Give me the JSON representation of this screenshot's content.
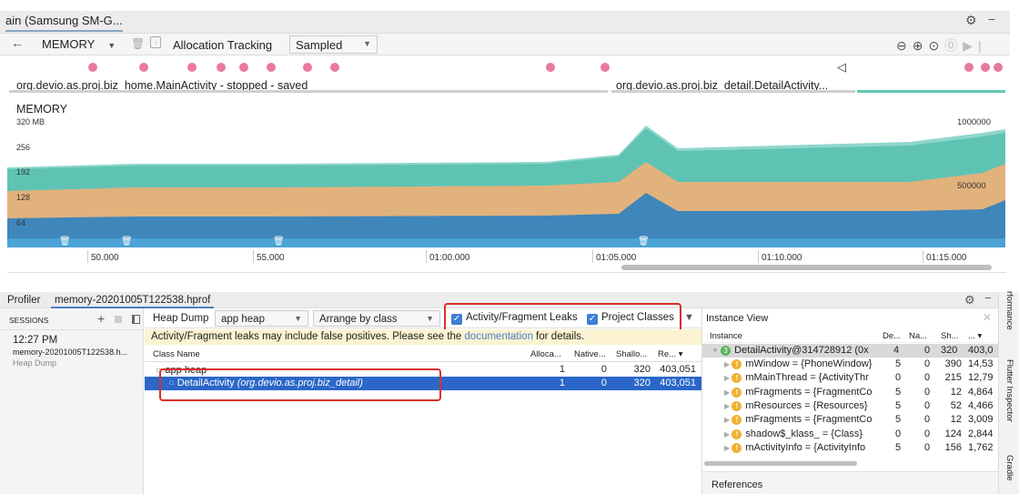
{
  "window": {
    "tab_title": "ain (Samsung SM-G..."
  },
  "toolbar": {
    "profiler_select": "MEMORY",
    "allocation_tracking_label": "Allocation Tracking",
    "allocation_mode": "Sampled"
  },
  "events": {
    "left_activity": "org.devio.as.proj.biz_home.MainActivity - stopped - saved",
    "right_activity": "org.devio.as.proj.biz_detail.DetailActivity...",
    "event_color": "#e879a0"
  },
  "chart": {
    "title": "MEMORY",
    "y_ticks": [
      "320 MB",
      "256",
      "192",
      "128",
      "64"
    ],
    "right_ticks": [
      "1000000",
      "500000"
    ],
    "x_ticks": [
      "50.000",
      "55.000",
      "01:00.000",
      "01:05.000",
      "01:10.000",
      "01:15.000"
    ],
    "layer_colors": {
      "java": "#3f86bb",
      "native": "#e2b27c",
      "graphics": "#5fc3b3",
      "code": "#8fd6cc",
      "other": "#4ba3d6"
    }
  },
  "bottom": {
    "tabs": [
      "Profiler",
      "memory-20201005T122538.hprof"
    ]
  },
  "sessions": {
    "header": "SESSIONS",
    "time": "12:27 PM",
    "name": "memory-20201005T122538.h...",
    "type": "Heap Dump"
  },
  "heap": {
    "view_label": "Heap Dump",
    "heap_select": "app heap",
    "arrange_select": "Arrange by class",
    "leaks_checkbox": "Activity/Fragment Leaks",
    "project_checkbox": "Project Classes",
    "warning_prefix": "Activity/Fragment leaks may include false positives. Please see the ",
    "warning_link": "documentation",
    "warning_suffix": " for details.",
    "columns": [
      "Class Name",
      "Alloca...",
      "Native...",
      "Shallo...",
      "Re..."
    ],
    "rows": [
      {
        "name": "app heap",
        "pkg": "",
        "alloc": "1",
        "native": "0",
        "shallow": "320",
        "retained": "403,051"
      },
      {
        "name": "DetailActivity",
        "pkg": "(org.devio.as.proj.biz_detail)",
        "alloc": "1",
        "native": "0",
        "shallow": "320",
        "retained": "403,051"
      }
    ]
  },
  "instance": {
    "title": "Instance View",
    "columns": [
      "Instance",
      "De...",
      "Na...",
      "Sh...",
      "..."
    ],
    "root": {
      "name": "DetailActivity@314728912 (0x",
      "depth": "4",
      "native": "0",
      "shallow": "320",
      "retained": "403,0"
    },
    "fields": [
      {
        "name": "mWindow = {PhoneWindow}",
        "depth": "5",
        "native": "0",
        "shallow": "390",
        "retained": "14,53"
      },
      {
        "name": "mMainThread = {ActivityThr",
        "depth": "0",
        "native": "0",
        "shallow": "215",
        "retained": "12,79"
      },
      {
        "name": "mFragments = {FragmentCo",
        "depth": "5",
        "native": "0",
        "shallow": "12",
        "retained": "4,864"
      },
      {
        "name": "mResources = {Resources}",
        "depth": "5",
        "native": "0",
        "shallow": "52",
        "retained": "4,466"
      },
      {
        "name": "mFragments = {FragmentCo",
        "depth": "5",
        "native": "0",
        "shallow": "12",
        "retained": "3,009"
      },
      {
        "name": "shadow$_klass_ = {Class}",
        "depth": "0",
        "native": "0",
        "shallow": "124",
        "retained": "2,844"
      },
      {
        "name": "mActivityInfo = {ActivityInfo",
        "depth": "5",
        "native": "0",
        "shallow": "156",
        "retained": "1,762"
      }
    ],
    "references_label": "References"
  },
  "side_tools": [
    "rformance",
    "Flutter Inspector",
    "Gradle"
  ]
}
